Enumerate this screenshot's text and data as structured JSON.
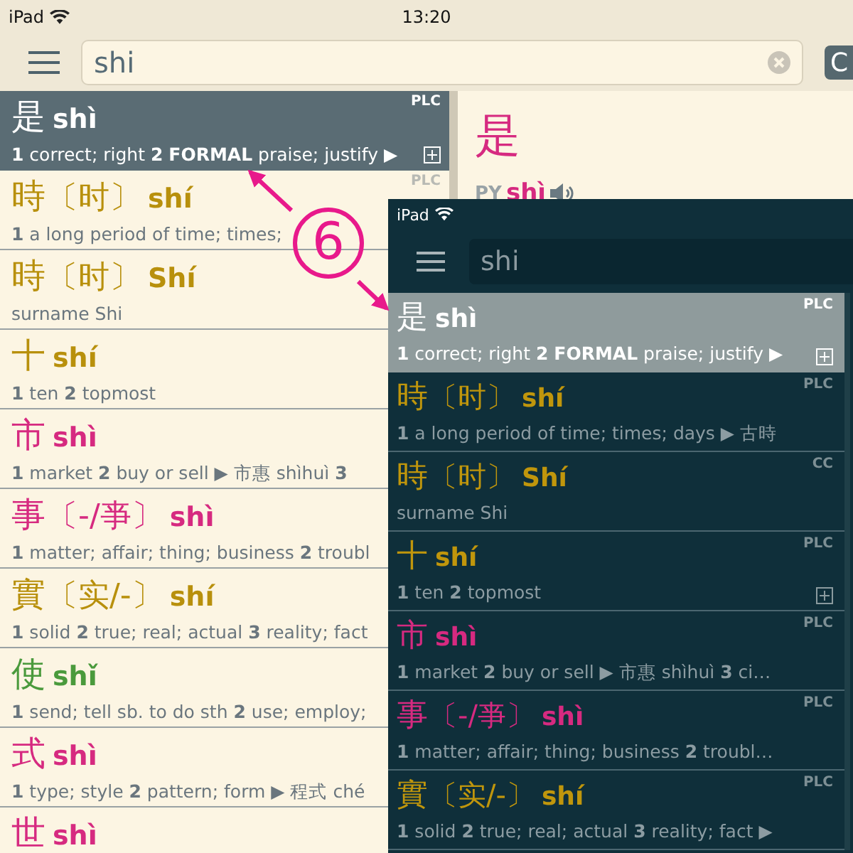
{
  "status_bar": {
    "device": "iPad",
    "time": "13:20"
  },
  "search": {
    "value": "shi"
  },
  "side_button": {
    "label": "C"
  },
  "entries": [
    {
      "hanzi": "是",
      "pinyin": "shì",
      "definition": "**1** correct; right  **2**  **FORMAL** praise; justify ▶",
      "source": "PLC",
      "selected": true,
      "expandable": true
    },
    {
      "hanzi": "時",
      "variant": "〔时〕",
      "pinyin": "shí",
      "color": "#b8900c",
      "definition": "**1** a long period of time; times;",
      "source": "PLC",
      "selected": false
    },
    {
      "hanzi": "時",
      "variant": "〔时〕",
      "pinyin": "Shí",
      "color": "#b8900c",
      "definition": "surname Shi",
      "selected": false
    },
    {
      "hanzi": "十",
      "pinyin": "shí",
      "color": "#b8900c",
      "definition": "**1** ten  **2** topmost",
      "selected": false
    },
    {
      "hanzi": "市",
      "pinyin": "shì",
      "color": "#d62a80",
      "definition": "**1** market  **2** buy or sell ▶ 市惠 shìhuì  **3**",
      "selected": false
    },
    {
      "hanzi": "事",
      "variant": "〔-/亊〕",
      "pinyin": "shì",
      "color": "#d62a80",
      "definition": "**1** matter; affair; thing; business  **2** troubl",
      "selected": false
    },
    {
      "hanzi": "實",
      "variant": "〔实/-〕",
      "pinyin": "shí",
      "color": "#b8900c",
      "definition": "**1** solid  **2** true; real; actual  **3** reality; fact",
      "selected": false
    },
    {
      "hanzi": "使",
      "pinyin": "shǐ",
      "color": "#4a9a3c",
      "definition": "**1** send; tell sb. to do sth  **2** use; employ;",
      "selected": false
    },
    {
      "hanzi": "式",
      "pinyin": "shì",
      "color": "#d62a80",
      "definition": "**1** type; style  **2** pattern; form ▶ 程式 ché",
      "selected": false
    },
    {
      "hanzi": "世",
      "pinyin": "shì",
      "color": "#d62a80",
      "selected": false
    }
  ],
  "detail": {
    "hanzi": "是",
    "py_label": "PY",
    "pinyin": "shì",
    "color": "#d62a80"
  },
  "annotation": {
    "number": "6"
  },
  "overlay": {
    "status_bar": {
      "device": "iPad"
    },
    "search": {
      "value": "shi"
    },
    "entries": [
      {
        "hanzi": "是",
        "pinyin": "shì",
        "definition": "**1** correct; right  **2**  **FORMAL** praise; justify ▶",
        "source": "PLC",
        "selected": true,
        "expandable": true
      },
      {
        "hanzi": "時",
        "variant": "〔时〕",
        "pinyin": "shí",
        "color": "#c0960c",
        "definition": "**1** a long period of time; times; days ▶ 古時",
        "source": "PLC",
        "selected": false,
        "expandable": false
      },
      {
        "hanzi": "時",
        "variant": "〔时〕",
        "pinyin": "Shí",
        "color": "#c0960c",
        "definition": "surname Shi",
        "source": "CC",
        "selected": false,
        "expandable": false
      },
      {
        "hanzi": "十",
        "pinyin": "shí",
        "color": "#c0960c",
        "definition": "**1** ten  **2** topmost",
        "source": "PLC",
        "selected": false,
        "expandable": true
      },
      {
        "hanzi": "市",
        "pinyin": "shì",
        "color": "#d62a80",
        "definition": "**1** market  **2** buy or sell ▶ 市惠 shìhuì  **3** ci…",
        "source": "PLC",
        "selected": false,
        "expandable": false
      },
      {
        "hanzi": "事",
        "variant": "〔-/亊〕",
        "pinyin": "shì",
        "color": "#d62a80",
        "definition": "**1** matter; affair; thing; business  **2** troubl…",
        "source": "PLC",
        "selected": false,
        "expandable": false
      },
      {
        "hanzi": "實",
        "variant": "〔实/-〕",
        "pinyin": "shí",
        "color": "#c0960c",
        "definition": "**1** solid  **2** true; real; actual  **3** reality; fact ▶",
        "source": "PLC",
        "selected": false,
        "expandable": false
      }
    ]
  }
}
